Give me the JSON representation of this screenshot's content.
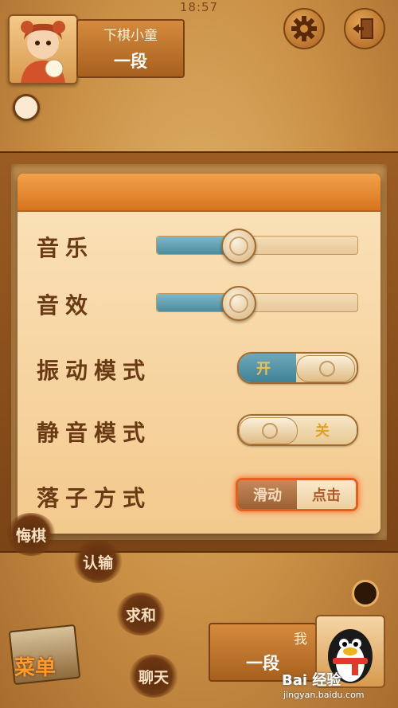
{
  "status_bar": {
    "time": "18:57"
  },
  "top_player": {
    "name": "下棋小童",
    "rank": "一段"
  },
  "settings": {
    "music": {
      "label": "音乐",
      "level": 0.4
    },
    "sound_effects": {
      "label": "音效",
      "level": 0.4
    },
    "vibration_mode": {
      "label": "振动模式",
      "state": "开"
    },
    "mute_mode": {
      "label": "静音模式",
      "state": "关"
    },
    "move_method": {
      "label": "落子方式",
      "options": [
        "滑动",
        "点击"
      ],
      "selected": "点击"
    }
  },
  "actions": {
    "undo": "悔棋",
    "resign": "认输",
    "draw": "求和",
    "chat": "聊天",
    "menu": "菜单"
  },
  "bottom_player": {
    "name": "我",
    "rank": "一段"
  },
  "watermark": {
    "brand": "Bai 经验",
    "url": "jingyan.baidu.com"
  },
  "colors": {
    "accent": "#d8731f",
    "slider_fill": "#4a8ea0",
    "highlight": "#e0621e"
  }
}
